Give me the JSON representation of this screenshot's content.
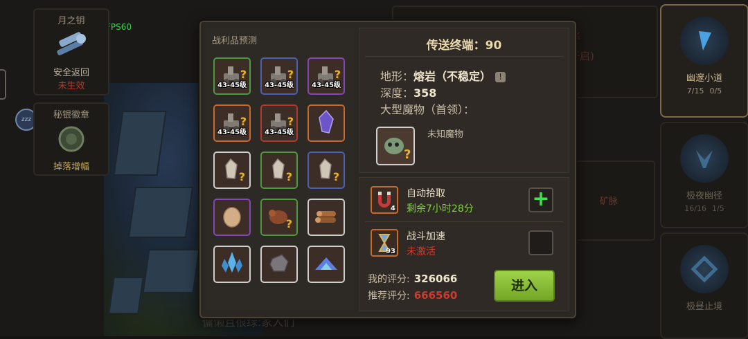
{
  "fps": "FPS60",
  "zzz": "zzz",
  "left_cards": [
    {
      "title": "月之钥",
      "subtitle": "安全返回",
      "status": "未生效"
    },
    {
      "title": "秘银徽章",
      "subtitle": "掉落增幅"
    }
  ],
  "routes": [
    {
      "name": "幽邃小道",
      "stat1": "7/15",
      "stat2": "0/5",
      "active": true
    },
    {
      "name": "极夜幽径",
      "stat1": "16/16",
      "stat2": "1/5",
      "active": false
    },
    {
      "name": "极昼止境",
      "active": false
    }
  ],
  "background": {
    "faint_text_1": "丝",
    "faint_text_2": "开启)",
    "chat": "慵懒且很绿:家人们",
    "mine": "矿脉"
  },
  "loot": {
    "title": "战利品预测",
    "items": [
      {
        "icon": "cannon-icon",
        "rarity": "green",
        "level": "43-45级",
        "unknown": true
      },
      {
        "icon": "cannon-icon",
        "rarity": "blue",
        "level": "43-45级",
        "unknown": true
      },
      {
        "icon": "cannon-icon",
        "rarity": "purple",
        "level": "43-45级",
        "unknown": true
      },
      {
        "icon": "cannon-icon",
        "rarity": "orange",
        "level": "43-45级",
        "unknown": true
      },
      {
        "icon": "cannon-icon",
        "rarity": "red",
        "level": "43-45级",
        "unknown": true
      },
      {
        "icon": "purple-crystal-icon",
        "rarity": "orange",
        "level": "",
        "unknown": false
      },
      {
        "icon": "white-crystal-icon",
        "rarity": "white",
        "level": "",
        "unknown": true
      },
      {
        "icon": "white-crystal-icon",
        "rarity": "green",
        "level": "",
        "unknown": true
      },
      {
        "icon": "white-crystal-icon",
        "rarity": "blue",
        "level": "",
        "unknown": true
      },
      {
        "icon": "egg-icon",
        "rarity": "purple",
        "level": "",
        "unknown": false
      },
      {
        "icon": "creature-icon",
        "rarity": "green",
        "level": "",
        "unknown": true
      },
      {
        "icon": "wood-logs-icon",
        "rarity": "white",
        "level": "",
        "unknown": false
      },
      {
        "icon": "blue-crystal-cluster-icon",
        "rarity": "white",
        "level": "",
        "unknown": false
      },
      {
        "icon": "stone-ore-icon",
        "rarity": "white",
        "level": "",
        "unknown": false
      },
      {
        "icon": "blue-powder-icon",
        "rarity": "white",
        "level": "",
        "unknown": false
      }
    ]
  },
  "info": {
    "terminal": "传送终端：90",
    "terrain_label": "地形：",
    "terrain_value": "熔岩（不稳定）",
    "depth_label": "深度：",
    "depth_value": "358",
    "boss_label": "大型魔物（首领）：",
    "boss_name": "未知魔物",
    "warn_glyph": "!"
  },
  "buffs": [
    {
      "name": "自动拾取",
      "status": "剩余7小时28分",
      "count": "4",
      "status_color": "#7cd33b"
    },
    {
      "name": "战斗加速",
      "status": "未激活",
      "count": "93",
      "status_color": "#d0392b"
    }
  ],
  "scores": {
    "my_label": "我的评分:",
    "my_value": "326066",
    "rec_label": "推荐评分:",
    "rec_value": "666560",
    "my_color": "#f1e7cf",
    "rec_color": "#d0392b"
  },
  "enter_label": "进入",
  "plus_glyph": "+"
}
